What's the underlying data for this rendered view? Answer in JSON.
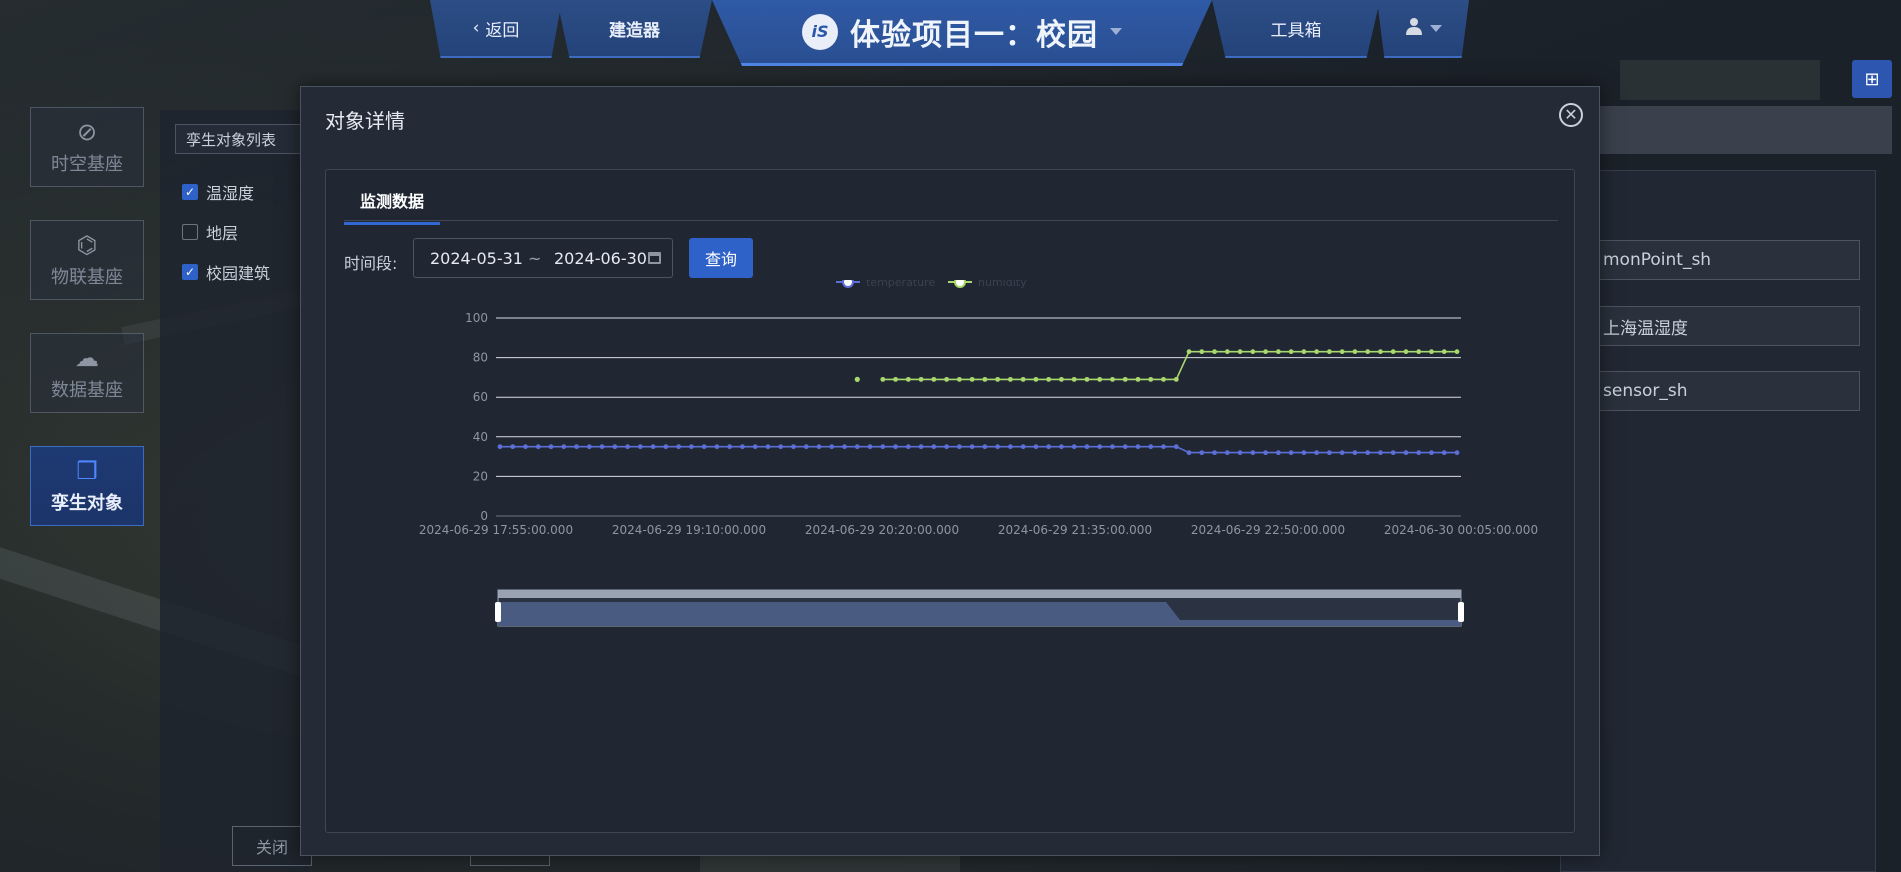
{
  "header": {
    "back_label": "返回",
    "builder_label": "建造器",
    "project_title": "体验项目一：校园",
    "logo_text": "iS",
    "tools_label": "工具箱"
  },
  "sidebar": {
    "items": [
      {
        "label": "时空基座",
        "icon": "compass-icon",
        "active": false
      },
      {
        "label": "物联基座",
        "icon": "network-icon",
        "active": false
      },
      {
        "label": "数据基座",
        "icon": "cloud-data-icon",
        "active": false
      },
      {
        "label": "孪生对象",
        "icon": "cubes-icon",
        "active": true
      }
    ]
  },
  "object_list": {
    "select_label": "孪生对象列表",
    "items": [
      {
        "label": "温湿度",
        "checked": true
      },
      {
        "label": "地层",
        "checked": false
      },
      {
        "label": "校园建筑",
        "checked": true
      }
    ],
    "close_label": "关闭"
  },
  "right_panel": {
    "fields": [
      "monPoint_sh",
      "上海温湿度",
      "sensor_sh"
    ]
  },
  "modal": {
    "title": "对象详情",
    "tab_label": "监测数据",
    "range_label": "时间段:",
    "start_date": "2024-05-31",
    "tilde": "~",
    "end_date": "2024-06-30",
    "query_label": "查询"
  },
  "colors": {
    "accent": "#2f62c8",
    "series_temperature": "#5b6fd6",
    "series_humidity": "#a9d86e"
  },
  "chart_data": {
    "type": "line",
    "xlabel": "",
    "ylabel": "",
    "ylim": [
      0,
      100
    ],
    "yticks": [
      0,
      20,
      40,
      60,
      80,
      100
    ],
    "xticks": [
      "2024-06-29 17:55:00.000",
      "2024-06-29 19:10:00.000",
      "2024-06-29 20:20:00.000",
      "2024-06-29 21:35:00.000",
      "2024-06-29 22:50:00.000",
      "2024-06-30 00:05:00.000"
    ],
    "legend": [
      "temperature",
      "humidity"
    ],
    "grid": true,
    "point_count": 76,
    "series": [
      {
        "name": "temperature",
        "color": "#5b6fd6",
        "segments": [
          {
            "from_index": 0,
            "to_index": 53,
            "value": 35
          },
          {
            "from_index": 54,
            "to_index": 75,
            "value": 32
          }
        ]
      },
      {
        "name": "humidity",
        "color": "#a9d86e",
        "isolated_points": [
          {
            "index": 28,
            "value": 69
          }
        ],
        "segments": [
          {
            "from_index": 30,
            "to_index": 53,
            "value": 69
          },
          {
            "from_index": 54,
            "to_index": 75,
            "value": 83
          }
        ]
      }
    ]
  }
}
